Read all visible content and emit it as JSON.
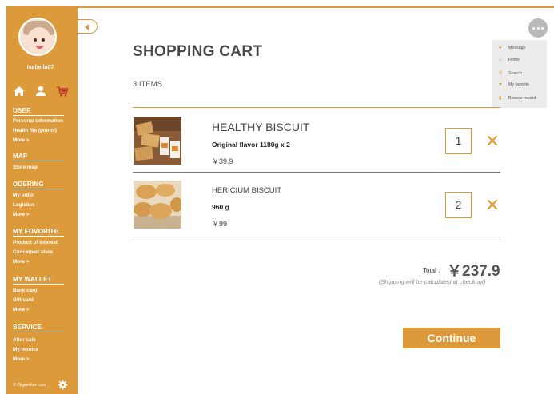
{
  "user": {
    "name": "Isabella07"
  },
  "sidebar": {
    "quick_icons": [
      "home-icon",
      "user-icon",
      "cart-icon"
    ],
    "sections": [
      {
        "title": "USER",
        "items": [
          "Personal information",
          "Health file (points)",
          "More >"
        ]
      },
      {
        "title": "MAP",
        "items": [
          "Store map"
        ]
      },
      {
        "title": "ODERING",
        "items": [
          "My order",
          "Logistics",
          "More >"
        ]
      },
      {
        "title": "MY FOVORITE",
        "items": [
          "Product of interest",
          "Concerned store",
          "More >"
        ]
      },
      {
        "title": "MY WALLET",
        "items": [
          "Bank card",
          "Gift card",
          "More >"
        ]
      },
      {
        "title": "SERVICE",
        "items": [
          "After sale",
          "My invoice",
          "More >"
        ]
      }
    ],
    "brand": "© Organiker.com"
  },
  "menu": {
    "items": [
      {
        "icon": "message-icon",
        "label": "Message"
      },
      {
        "icon": "home-icon",
        "label": "Home"
      },
      {
        "icon": "search-icon",
        "label": "Search"
      },
      {
        "icon": "heart-icon",
        "label": "My favorite"
      },
      {
        "icon": "document-icon",
        "label": "Browse record"
      }
    ]
  },
  "cart": {
    "title": "SHOPPING CART",
    "count_label": "3 ITEMS",
    "items": [
      {
        "name": "HEALTHY  BISCUIT",
        "spec": "Original flavor 1180g x 2",
        "price": "￥39.9",
        "quantity": "1"
      },
      {
        "name": "HERICIUM BISCUIT",
        "spec": "960 g",
        "price": "￥99",
        "quantity": "2"
      }
    ],
    "total_label": "Total :",
    "total_value": "￥237.9",
    "shipping_note": "(Shipping will be calculated at checkout)",
    "continue_label": "Continue"
  },
  "colors": {
    "accent": "#dd9a3b",
    "menu_bg": "#ececec",
    "more_button": "#b9b9b9"
  }
}
